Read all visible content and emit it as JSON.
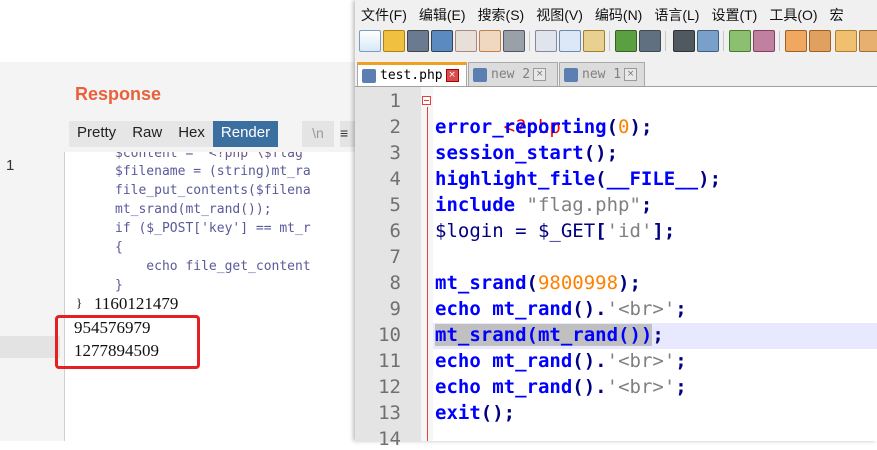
{
  "burp": {
    "response_title": "Response",
    "view_tabs": [
      "Pretty",
      "Raw",
      "Hex",
      "Render"
    ],
    "active_view_tab": "Render",
    "newline_toggle": "\\n",
    "menu_glyph": "≡",
    "line_number": "1",
    "response_code_lines": [
      "$content = '<?php \\$flag",
      "$filename = (string)mt_ra",
      "file_put_contents($filena",
      "mt_srand(mt_rand());",
      "if ($_POST['key'] == mt_r",
      "{",
      "    echo file_get_content",
      "}"
    ],
    "output_numbers": [
      "1160121479",
      "954576979",
      "1277894509"
    ],
    "closing_tag_prefix": "} "
  },
  "notepadpp": {
    "menu": [
      "文件(F)",
      "编辑(E)",
      "搜索(S)",
      "视图(V)",
      "编码(N)",
      "语言(L)",
      "设置(T)",
      "工具(O)",
      "宏"
    ],
    "tabs": [
      {
        "label": "test.php",
        "active": true
      },
      {
        "label": "new 2",
        "active": false
      },
      {
        "label": "new 1",
        "active": false
      }
    ],
    "close_glyph": "×",
    "line_numbers": [
      "1",
      "2",
      "3",
      "4",
      "5",
      "6",
      "7",
      "8",
      "9",
      "10",
      "11",
      "12",
      "13",
      "14"
    ],
    "highlighted_line": 10,
    "code": {
      "l1_open_tag": "<?php",
      "l2_func": "error_reporting",
      "l2_open": "(",
      "l2_num": "0",
      "l2_close": ");",
      "l3_func": "session_start",
      "l3_rest": "();",
      "l4_func": "highlight_file",
      "l4_open": "(",
      "l4_const": "__FILE__",
      "l4_close": ");",
      "l5_kw": "include",
      "l5_str": " \"flag.php\"",
      "l5_end": ";",
      "l6_var": "$login",
      "l6_eq": " = ",
      "l6_get": "$_GET",
      "l6_open": "[",
      "l6_str": "'id'",
      "l6_close": "];",
      "l8_func": "mt_srand",
      "l8_open": "(",
      "l8_num": "9800998",
      "l8_close": ");",
      "l9_echo": "echo",
      "l9_sp": " ",
      "l9_func": "mt_rand",
      "l9_call": "().",
      "l9_str": "'<br>'",
      "l9_end": ";",
      "l10_sel": "mt_srand(mt_rand())",
      "l10_end": ";",
      "l11_echo": "echo",
      "l11_sp": " ",
      "l11_func": "mt_rand",
      "l11_call": "().",
      "l11_str": "'<br>'",
      "l11_end": ";",
      "l12_echo": "echo",
      "l12_sp": " ",
      "l12_func": "mt_rand",
      "l12_call": "().",
      "l12_str": "'<br>'",
      "l12_end": ";",
      "l13_kw": "exit",
      "l13_rest": "();"
    }
  },
  "colors": {
    "response_title": "#e8613a",
    "render_tab_active": "#3a6fa0",
    "highlight_box": "#e52020",
    "keyword_blue": "#0000ff",
    "number_orange": "#ff8000",
    "string_gray": "#808080",
    "php_tag_red": "#ff0000",
    "current_line": "#e8e8ff",
    "active_tab_accent": "#f0a020"
  }
}
